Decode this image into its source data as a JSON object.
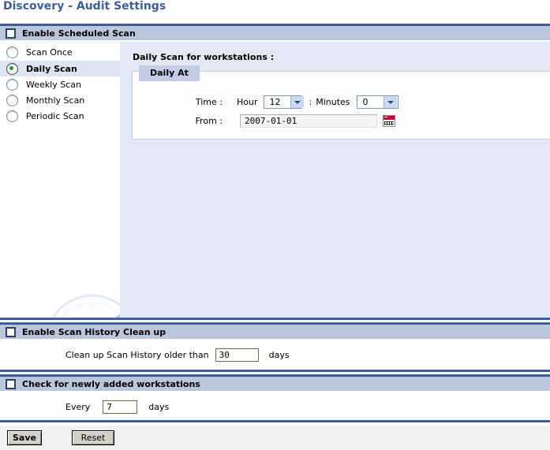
{
  "page": {
    "title": "Discovery - Audit Settings"
  },
  "sections": {
    "scheduled_scan": {
      "header_label": "Enable Scheduled Scan",
      "checkbox_checked": false,
      "schedule_options": [
        {
          "label": "Scan Once",
          "selected": false
        },
        {
          "label": "Daily Scan",
          "selected": true
        },
        {
          "label": "Weekly Scan",
          "selected": false
        },
        {
          "label": "Monthly Scan",
          "selected": false
        },
        {
          "label": "Periodic Scan",
          "selected": false
        }
      ],
      "content_heading": "Daily Scan for workstations :",
      "fieldset_legend": "Daily At",
      "time_label": "Time :",
      "hour_label": "Hour",
      "hour_value": "12",
      "time_separator": ":",
      "minutes_label": "Minutes",
      "minutes_value": "0",
      "from_label": "From :",
      "from_value": "2007-01-01",
      "calendar_icon": "calendar-icon",
      "watermark_icon": "clock-watermark"
    },
    "scan_history": {
      "header_label": "Enable Scan History Clean up",
      "checkbox_checked": false,
      "prefix_label": "Clean up Scan History older than",
      "days_value": "30",
      "suffix_label": "days"
    },
    "newly_added": {
      "header_label": "Check for newly added workstations",
      "checkbox_checked": false,
      "prefix_label": "Every",
      "days_value": "7",
      "suffix_label": "days"
    }
  },
  "buttons": {
    "save_label": "Save",
    "reset_label": "Reset"
  },
  "colors": {
    "title_blue": "#3c5f96",
    "header_band": "#b9c6dc",
    "header_border": "#3c5f96",
    "selected_row": "#dde4f3",
    "radio_dot_green": "#17a517",
    "content_bg": "#e4e8f5",
    "calendar_red": "#cc0033"
  }
}
